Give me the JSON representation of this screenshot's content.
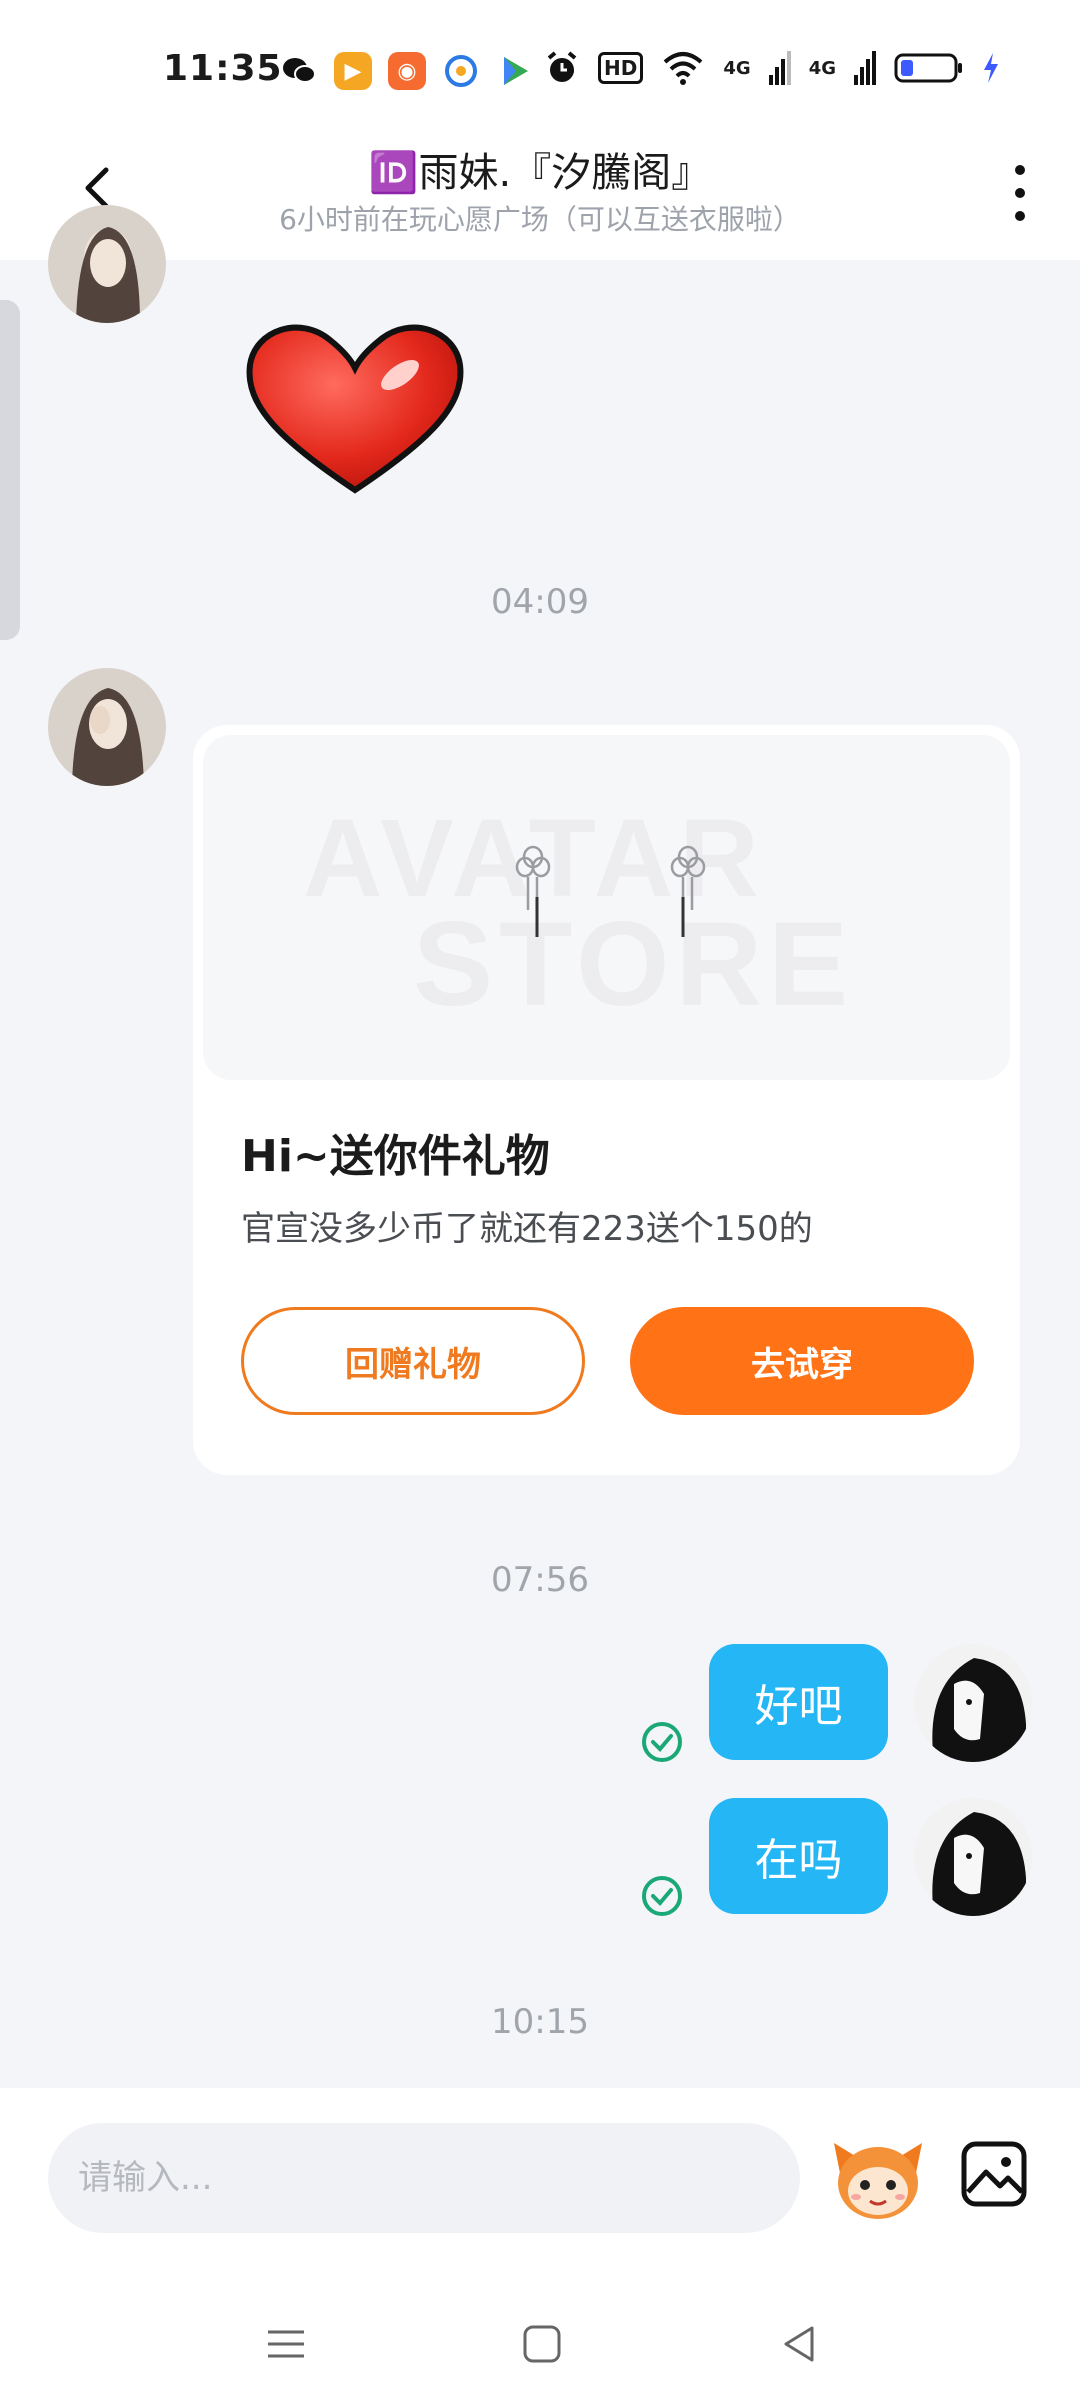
{
  "status_bar": {
    "time": "11:35",
    "hd_label": "HD",
    "signal1": "4G",
    "signal2": "4G",
    "app_icons": [
      "wechat-icon",
      "video-app-icon",
      "game-app-icon",
      "browser-app-icon",
      "play-store-icon"
    ]
  },
  "header": {
    "title": "🆔雨妹.『汐騰阁』",
    "subtitle": "6小时前在玩心愿广场（可以互送衣服啦）"
  },
  "messages": {
    "timestamp_1": "04:09",
    "gift_card": {
      "watermark_line1": "AVATAR",
      "watermark_line2": "STORE",
      "title": "Hi~送你件礼物",
      "description": "官宣没多少币了就还有223送个150的",
      "return_gift_label": "回赠礼物",
      "try_on_label": "去试穿"
    },
    "timestamp_2": "07:56",
    "outgoing": [
      {
        "text": "好吧"
      },
      {
        "text": "在吗"
      }
    ],
    "timestamp_3": "10:15"
  },
  "input_bar": {
    "placeholder": "请输入..."
  },
  "colors": {
    "accent_orange": "#ff7216",
    "bubble_blue": "#25b6f5",
    "sent_check_green": "#1aa876"
  }
}
